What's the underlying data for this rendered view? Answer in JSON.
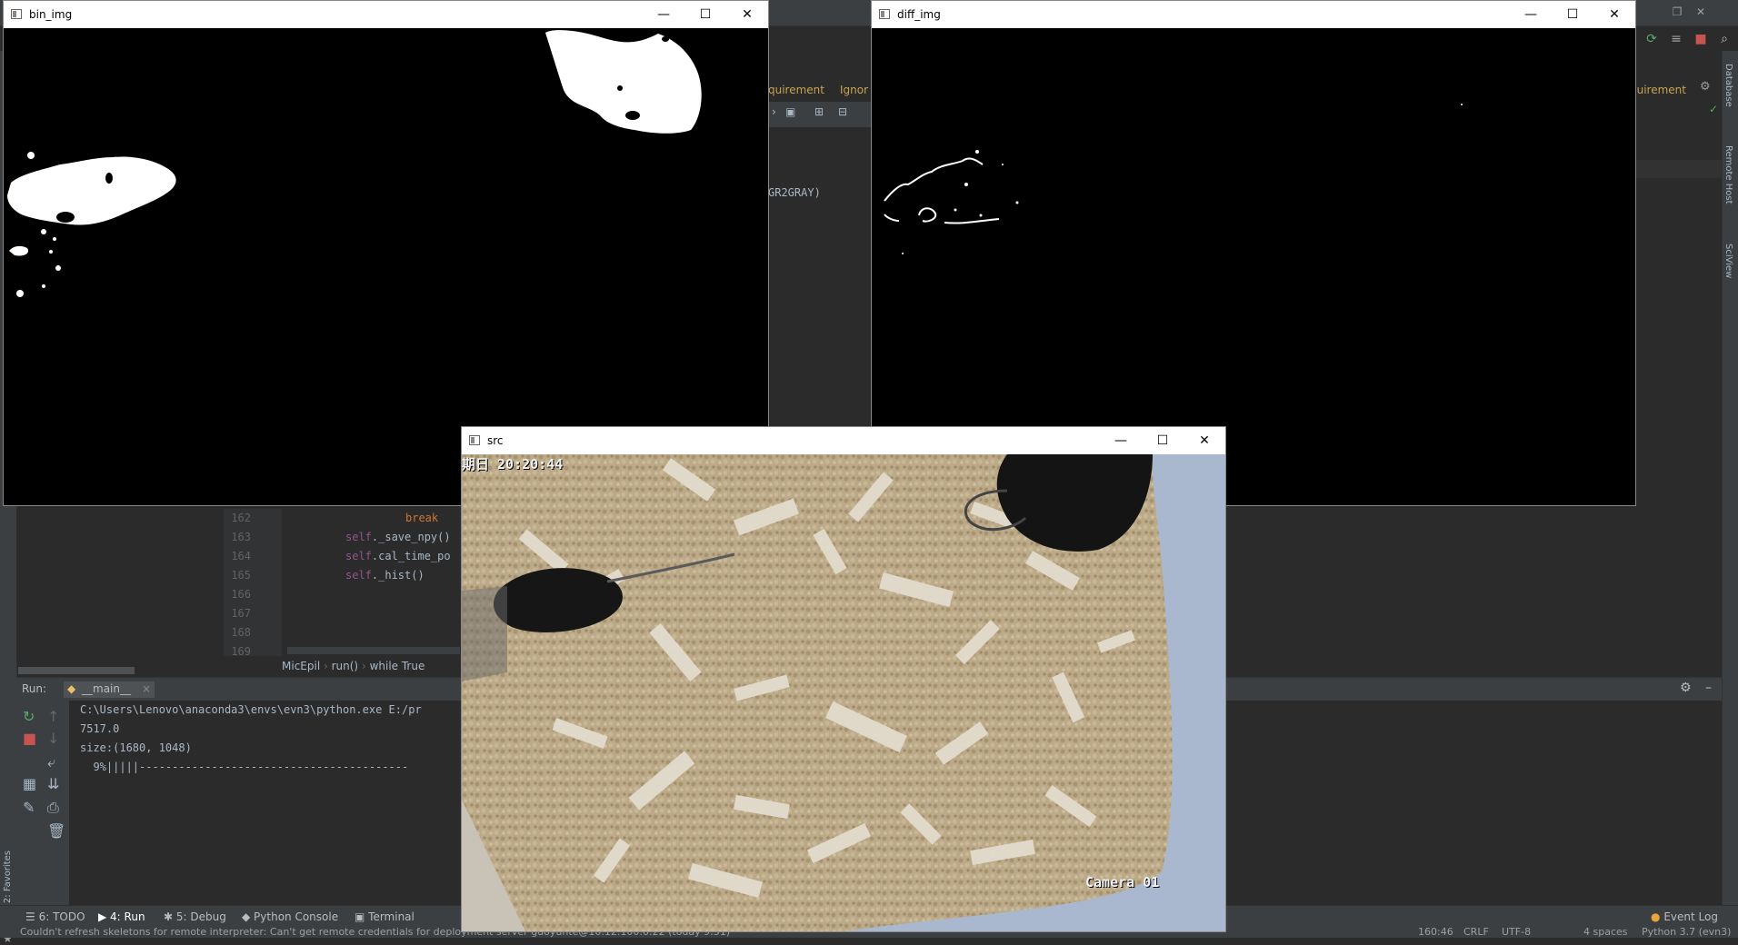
{
  "ide": {
    "right_tabs": [
      "Database",
      "Remote Host",
      "SciView"
    ],
    "left_tabs": [
      "2: Favorites"
    ],
    "tab_fragments": {
      "left": "quirement",
      "left2": "Ignor",
      "right": "quirement",
      "code_frag": "GR2GRAY)"
    },
    "editor": {
      "lines": [
        {
          "no": "162",
          "code": "break",
          "type": "kw"
        },
        {
          "no": "163",
          "code": "self._save_npy()",
          "type": "self"
        },
        {
          "no": "164",
          "code": "self.cal_time_po",
          "type": "self"
        },
        {
          "no": "165",
          "code": "self._hist()",
          "type": "self"
        },
        {
          "no": "166",
          "code": "",
          "type": ""
        },
        {
          "no": "167",
          "code": "",
          "type": ""
        },
        {
          "no": "168",
          "code": "",
          "type": ""
        },
        {
          "no": "169",
          "code": "",
          "type": ""
        }
      ],
      "breadcrumb": [
        "MicEpil",
        "run()",
        "while True"
      ]
    },
    "run": {
      "label": "Run:",
      "tab": "__main__",
      "console": [
        "C:\\Users\\Lenovo\\anaconda3\\envs\\evn3\\python.exe E:/pr",
        "7517.0",
        "size:(1680, 1048)",
        "  9%|||||-----------------------------------------"
      ]
    },
    "bottom_tabs": [
      "6: TODO",
      "4: Run",
      "5: Debug",
      "Python Console",
      "Terminal"
    ],
    "event_log": "Event Log",
    "status_message": "Couldn't refresh skeletons for remote interpreter: Can't get remote credentials for deployment server guoyunte@10.12.100.6:22 (today 9:51)",
    "status_right": [
      "160:46",
      "CRLF",
      "UTF-8",
      "4 spaces",
      "Python 3.7 (evn3)"
    ]
  },
  "windows": {
    "bin_img": {
      "title": "bin_img"
    },
    "diff_img": {
      "title": "diff_img"
    },
    "src": {
      "title": "src",
      "timestamp": "期日 20:20:44",
      "camera": "Camera 01"
    }
  },
  "colors": {
    "ide_bg": "#2b2b2b",
    "ide_panel": "#3c3f41",
    "accent_orange": "#cc7832",
    "self_purple": "#94558d",
    "tab_gold": "#c7a44f"
  }
}
